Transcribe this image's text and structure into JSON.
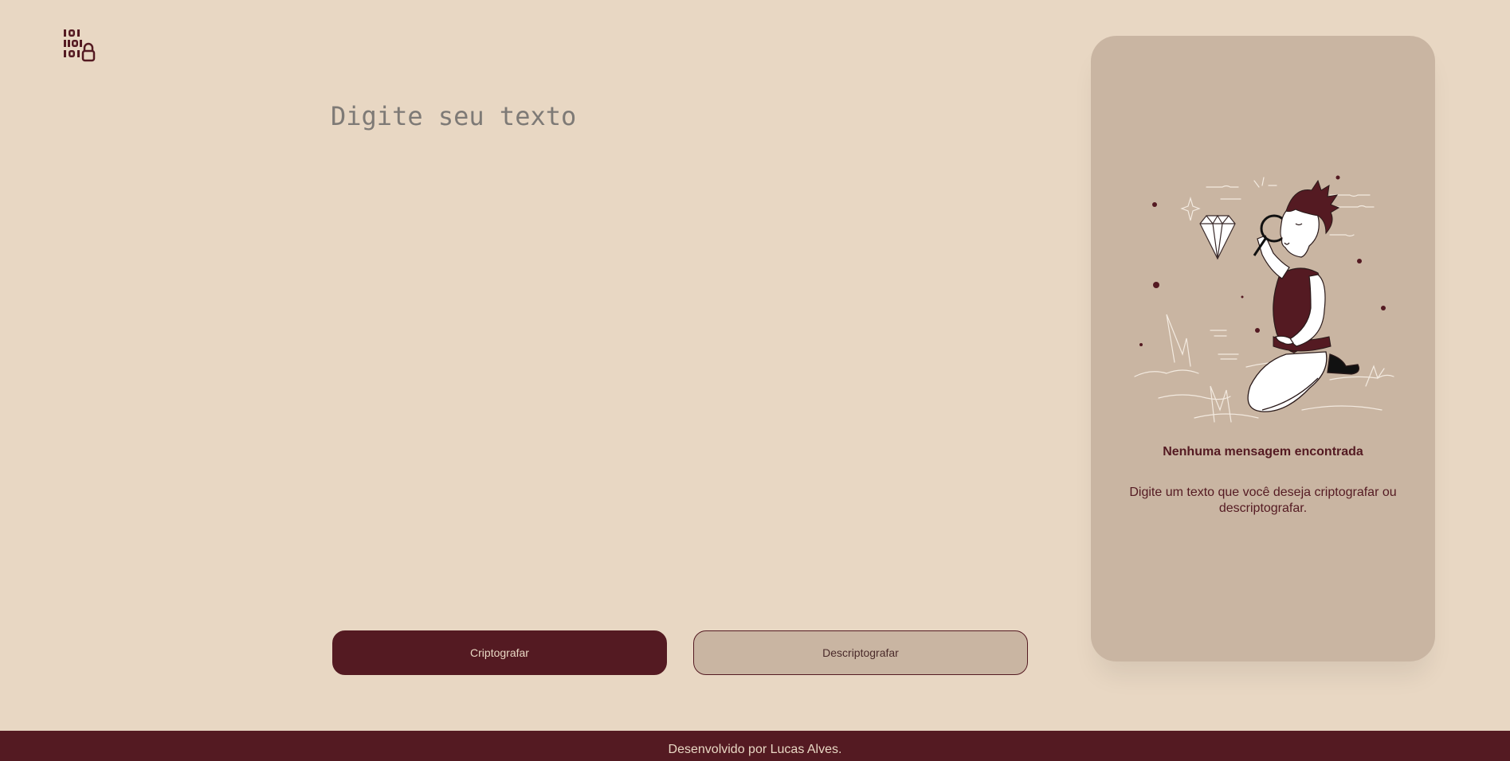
{
  "header": {
    "logo_icon": "binary-lock-icon"
  },
  "editor": {
    "placeholder": "Digite seu texto",
    "value": ""
  },
  "actions": {
    "encrypt_label": "Criptografar",
    "decrypt_label": "Descriptografar"
  },
  "output_panel": {
    "illustration": "person-with-magnifying-glass-and-diamond-illustration",
    "title": "Nenhuma mensagem encontrada",
    "message": "Digite um texto que você deseja criptografar ou descriptografar."
  },
  "footer": {
    "credit": "Desenvolvido por Lucas Alves."
  },
  "colors": {
    "background": "#E8D7C3",
    "accent": "#541A22",
    "panel": "#C9B5A2"
  }
}
